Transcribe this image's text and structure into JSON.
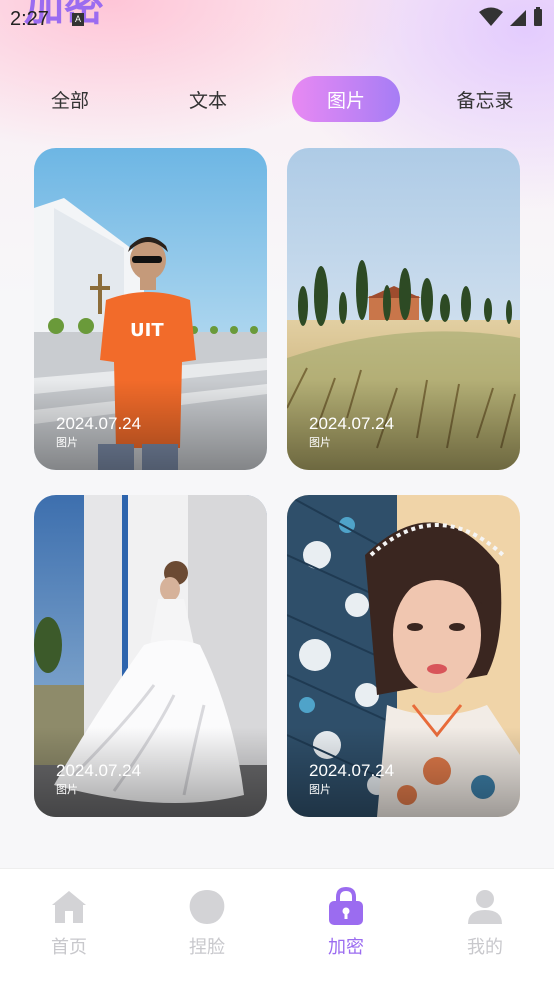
{
  "status_bar": {
    "time": "2:27",
    "a_badge": "A",
    "icons": [
      "wifi-icon",
      "signal-icon",
      "battery-icon"
    ]
  },
  "header_deco_text": "加密",
  "tabs": [
    {
      "label": "全部",
      "active": false
    },
    {
      "label": "文本",
      "active": false
    },
    {
      "label": "图片",
      "active": true
    },
    {
      "label": "备忘录",
      "active": false
    }
  ],
  "cards": [
    {
      "date": "2024.07.24",
      "type": "图片",
      "subject": "man in orange t-shirt near white chapel"
    },
    {
      "date": "2024.07.24",
      "type": "图片",
      "subject": "wheat field with cypress trees"
    },
    {
      "date": "2024.07.24",
      "type": "图片",
      "subject": "bride in white gown by wall"
    },
    {
      "date": "2024.07.24",
      "type": "图片",
      "subject": "woman with blue floral fan"
    }
  ],
  "bottom_nav": [
    {
      "label": "首页",
      "icon": "home-icon",
      "active": false
    },
    {
      "label": "捏脸",
      "icon": "face-icon",
      "active": false
    },
    {
      "label": "加密",
      "icon": "lock-icon",
      "active": true
    },
    {
      "label": "我的",
      "icon": "person-icon",
      "active": false
    }
  ],
  "colors": {
    "accent": "#9b6cf0",
    "tab_gradient_start": "#e889f3",
    "tab_gradient_end": "#a67df5",
    "nav_inactive": "#c8c8cc"
  }
}
